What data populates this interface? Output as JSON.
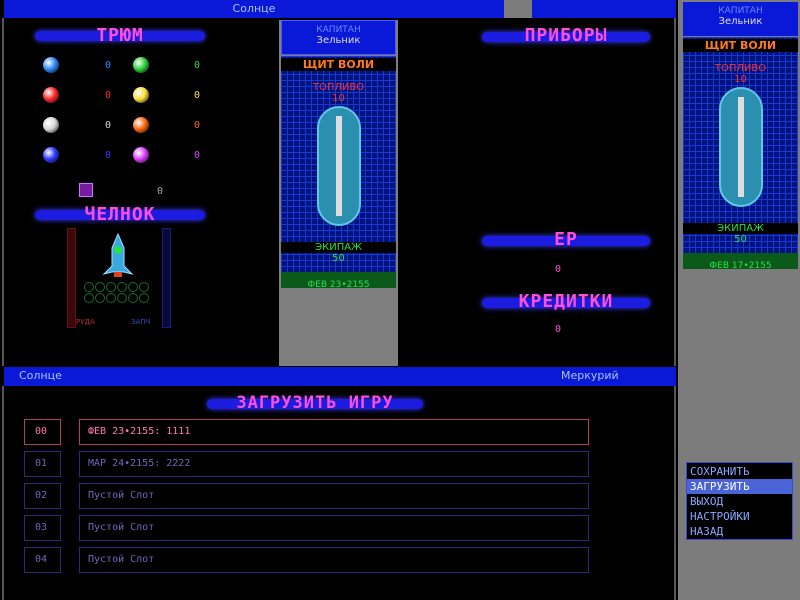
{
  "top_bar": {
    "left_label": "Солнце"
  },
  "cargo": {
    "title": "ТРЮМ",
    "items": [
      {
        "color": "#2f8cff",
        "count": "0"
      },
      {
        "color": "#2fd43a",
        "count": "0"
      },
      {
        "color": "#ff2a2a",
        "count": "0"
      },
      {
        "color": "#ffe03a",
        "count": "0"
      },
      {
        "color": "#d8d8d8",
        "count": "0"
      },
      {
        "color": "#ff6a10",
        "count": "0"
      },
      {
        "color": "#2f3bff",
        "count": "0"
      },
      {
        "color": "#e040ff",
        "count": "0"
      }
    ],
    "extra_count": "0"
  },
  "shuttle": {
    "title": "ЧЕЛНОК",
    "left_tube_label": "РУДА",
    "right_tube_label": "ЗАПЧ"
  },
  "flagship_center": {
    "captain_label": "КАПИТАН",
    "captain_name": "Зельник",
    "shield_label": "ЩИТ ВОЛИ",
    "fuel_label": "ТОПЛИВО",
    "fuel_value": "10",
    "crew_label": "ЭКИПАЖ",
    "crew_value": "50",
    "date": "ФЕВ 23•2155"
  },
  "devices": {
    "title": "ПРИБОРЫ"
  },
  "ep": {
    "title": "ЕР",
    "value": "0"
  },
  "credits": {
    "title": "КРЕДИТКИ",
    "value": "0"
  },
  "mid_bar": {
    "left_label": "Солнце",
    "right_label": "Меркурий"
  },
  "load_game": {
    "title": "ЗАГРУЗИТЬ ИГРУ",
    "slots": [
      {
        "num": "00",
        "text": "ФЕВ 23•2155: 1111"
      },
      {
        "num": "01",
        "text": "МАР 24•2155: 2222"
      },
      {
        "num": "02",
        "text": "Пустой Слот"
      },
      {
        "num": "03",
        "text": "Пустой Слот"
      },
      {
        "num": "04",
        "text": "Пустой Слот"
      }
    ]
  },
  "flagship_side": {
    "captain_label": "КАПИТАН",
    "captain_name": "Зельник",
    "shield_label": "ЩИТ ВОЛИ",
    "fuel_label": "ТОПЛИВО",
    "fuel_value": "10",
    "crew_label": "ЭКИПАЖ",
    "crew_value": "50",
    "date": "ФЕВ 17•2155"
  },
  "menu": {
    "items": [
      "СОХРАНИТЬ",
      "ЗАГРУЗИТЬ",
      "ВЫХОД",
      "НАСТРОЙКИ",
      "НАЗАД"
    ]
  },
  "colors": {
    "accent": "#ff4fd8",
    "bar": "#0a18d8",
    "selected_menu": "#4a64d8"
  }
}
